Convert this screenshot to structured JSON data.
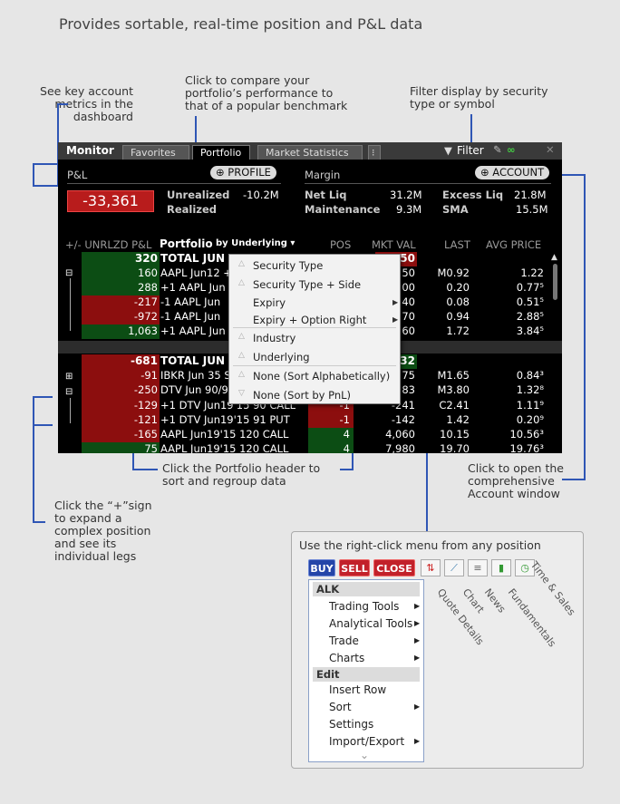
{
  "headline": "Provides sortable, real-time position and P&L data",
  "callouts": {
    "metrics": [
      "See key account",
      "metrics in the",
      "dashboard"
    ],
    "profile": [
      "Click to compare your",
      "portfolio’s performance to",
      "that of a popular benchmark"
    ],
    "filter": [
      "Filter display by security",
      "type or symbol"
    ],
    "header": [
      "Click the Portfolio header to",
      "sort and regroup data"
    ],
    "account": [
      "Click to open the",
      "comprehensive",
      "Account window"
    ],
    "expand": [
      "Click the “+”sign",
      "to expand a",
      "complex position",
      "and see its",
      "individual legs"
    ],
    "rightclick": "Use the right-click menu from any position"
  },
  "window": {
    "title": "Monitor",
    "tabs": [
      "Favorites",
      "Portfolio",
      "Market Statistics"
    ],
    "filter_label": "Filter",
    "pnl_label": "P&L",
    "profile_btn": "PROFILE",
    "pnl_value": "-33,361",
    "unrealized_label": "Unrealized",
    "unrealized_value": "-10.2M",
    "realized_label": "Realized",
    "margin_label": "Margin",
    "account_btn": "ACCOUNT",
    "netliq_label": "Net Liq",
    "netliq_value": "31.2M",
    "maint_label": "Maintenance",
    "maint_value": "9.3M",
    "excess_label": "Excess Liq",
    "excess_value": "21.8M",
    "sma_label": "SMA",
    "sma_value": "15.5M",
    "columns": {
      "unrlzd": "+/- UNRLZD P&L",
      "portfolio": "Portfolio",
      "by": "by Underlying",
      "pos": "POS",
      "mktval": "MKT VAL",
      "last": "LAST",
      "avg": "AVG PRICE"
    },
    "rows": [
      {
        "pnl": "320",
        "name": "TOTAL JUN",
        "pos": "",
        "mkt": "50",
        "last": "",
        "avg": ""
      },
      {
        "pnl": "160",
        "name": "AAPL Jun12 +",
        "pos": "",
        "mkt": "50",
        "last": "M0.92",
        "avg": "1.22"
      },
      {
        "pnl": "288",
        "name": "+1 AAPL Jun",
        "pos": "",
        "mkt": "00",
        "last": "0.20",
        "avg": "0.77⁵"
      },
      {
        "pnl": "-217",
        "name": "-1 AAPL Jun",
        "pos": "",
        "mkt": "40",
        "last": "0.08",
        "avg": "0.51⁵"
      },
      {
        "pnl": "-972",
        "name": "-1 AAPL Jun",
        "pos": "",
        "mkt": "70",
        "last": "0.94",
        "avg": "2.88⁵"
      },
      {
        "pnl": "1,063",
        "name": "+1 AAPL Jun",
        "pos": "",
        "mkt": "60",
        "last": "1.72",
        "avg": "3.84⁵"
      },
      {
        "pnl": "-681",
        "name": "TOTAL JUN",
        "pos": "",
        "mkt": "32",
        "last": "",
        "avg": ""
      },
      {
        "pnl": "-91",
        "name": "IBKR Jun 35 S",
        "pos": "",
        "mkt": "75",
        "last": "M1.65",
        "avg": "0.84³"
      },
      {
        "pnl": "-250",
        "name": "DTV Jun 90/9",
        "pos": "",
        "mkt": "83",
        "last": "M3.80",
        "avg": "1.32⁸"
      },
      {
        "pnl": "-129",
        "name": "+1 DTV Jun19'15 90 CALL",
        "pos": "-1",
        "mkt": "-241",
        "last": "C2.41",
        "avg": "1.11⁹"
      },
      {
        "pnl": "-121",
        "name": "+1 DTV Jun19'15 91 PUT",
        "pos": "-1",
        "mkt": "-142",
        "last": "1.42",
        "avg": "0.20⁹"
      },
      {
        "pnl": "-165",
        "name": "AAPL Jun19'15 120 CALL",
        "pos": "4",
        "mkt": "4,060",
        "last": "10.15",
        "avg": "10.56³"
      },
      {
        "pnl": "75",
        "name": "AAPL Jun19'15 120 CALL",
        "pos": "4",
        "mkt": "7,980",
        "last": "19.70",
        "avg": "19.76³"
      }
    ],
    "sort_menu": [
      "Security Type",
      "Security Type + Side",
      "Expiry",
      "Expiry + Option Right",
      "Industry",
      "Underlying",
      "None (Sort Alphabetically)",
      "None (Sort by PnL)"
    ]
  },
  "rightpanel": {
    "buttons": [
      "BUY",
      "SELL",
      "CLOSE"
    ],
    "tool_labels": [
      "Quote Details",
      "Chart",
      "News",
      "Fundamentals",
      "Time & Sales"
    ],
    "symbol": "ALK",
    "items1": [
      "Trading Tools",
      "Analytical Tools",
      "Trade",
      "Charts"
    ],
    "edit_header": "Edit",
    "items2": [
      "Insert Row",
      "Sort",
      "Settings",
      "Import/Export"
    ]
  }
}
